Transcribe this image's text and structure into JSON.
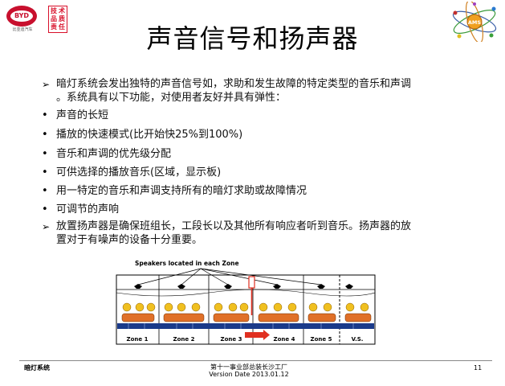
{
  "header": {
    "brand_logo_text": "BYD",
    "brand_logo_subtitle": "比亚迪汽车",
    "motto_chars": [
      "技",
      "术",
      "品",
      "质",
      "责",
      "任"
    ],
    "badge_text": "AMS"
  },
  "slide": {
    "title": "声音信号和扬声器",
    "intro_line1": "暗灯系统会发出独特的声音信号如，求助和发生故障的特定类型的音乐和声调",
    "intro_line2": "。系统具有以下功能，对使用者友好并具有弹性：",
    "bullets": [
      "声音的长短",
      "播放的快速模式(比开始快25%到100%)",
      "音乐和声调的优先级分配",
      "可供选择的播放音乐(区域，显示板)",
      "用一特定的音乐和声调支持所有的暗灯求助或故障情况",
      "可调节的声响"
    ],
    "para2_line1": "放置扬声器是确保班组长，工段长以及其他所有响应者听到音乐。扬声器的放",
    "para2_line2": "置对于有噪声的设备十分重要。"
  },
  "diagram": {
    "caption": "Speakers located in each Zone",
    "zones": [
      "Zone 1",
      "Zone 2",
      "Zone 3",
      "Zone 4",
      "Zone 5",
      "V.S."
    ]
  },
  "footer": {
    "left": "暗灯系统",
    "center_line1": "第十一事业部总装长沙工厂",
    "center_line2": "Version Date 2013.01.12",
    "page_number": "11"
  },
  "colors": {
    "brand_red": "#c8102e",
    "alert_red": "#e03020",
    "zone_blue": "#1a3a8a"
  }
}
